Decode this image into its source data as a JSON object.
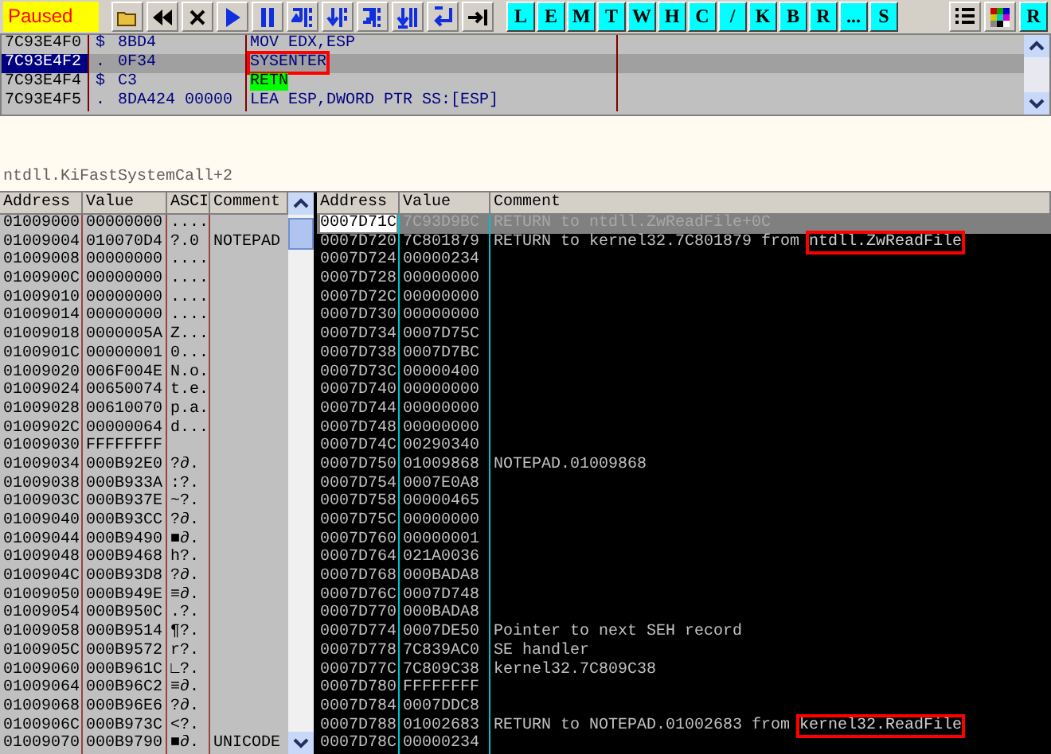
{
  "toolbar": {
    "status": "Paused",
    "tools": [
      {
        "kind": "open"
      },
      {
        "kind": "restart"
      },
      {
        "kind": "close"
      },
      {
        "kind": "run"
      },
      {
        "kind": "pause"
      },
      {
        "kind": "step-in"
      },
      {
        "kind": "step-over"
      },
      {
        "kind": "trace-in"
      },
      {
        "kind": "trace-over"
      },
      {
        "kind": "till-return"
      },
      {
        "kind": "goto"
      }
    ],
    "letters": [
      "L",
      "E",
      "M",
      "T",
      "W",
      "H",
      "C",
      "/",
      "K",
      "B",
      "R",
      "...",
      "S"
    ],
    "right_tools": [
      {
        "kind": "list"
      },
      {
        "kind": "grid"
      },
      {
        "kind": "letter",
        "label": "R"
      }
    ]
  },
  "disassembly": {
    "rows": [
      {
        "address": "7C93E4F0",
        "mark": "$",
        "hex": "8BD4",
        "instruction": "MOV EDX,ESP",
        "selected": false,
        "kind": "plain"
      },
      {
        "address": "7C93E4F2",
        "mark": ".",
        "hex": "0F34",
        "instruction": "SYSENTER",
        "selected": true,
        "kind": "boxed"
      },
      {
        "address": "7C93E4F4",
        "mark": "$",
        "hex": "C3",
        "instruction": "RETN",
        "selected": false,
        "kind": "return"
      },
      {
        "address": "7C93E4F5",
        "mark": ".",
        "hex": "8DA424 00000",
        "instruction": "LEA ESP,DWORD PTR SS:[ESP]",
        "selected": false,
        "kind": "plain"
      }
    ]
  },
  "info": {
    "text": "ntdll.KiFastSystemCall+2"
  },
  "dump": {
    "columns": [
      "Address",
      "Value",
      "ASCI",
      "Comment"
    ],
    "rows": [
      {
        "address": "01009000",
        "value": "00000000",
        "ascii": "...."
      },
      {
        "address": "01009004",
        "value": "010070D4",
        "ascii": "?.0",
        "comment": "NOTEPAD"
      },
      {
        "address": "01009008",
        "value": "00000000",
        "ascii": "...."
      },
      {
        "address": "0100900C",
        "value": "00000000",
        "ascii": "...."
      },
      {
        "address": "01009010",
        "value": "00000000",
        "ascii": "...."
      },
      {
        "address": "01009014",
        "value": "00000000",
        "ascii": "...."
      },
      {
        "address": "01009018",
        "value": "0000005A",
        "ascii": "Z..."
      },
      {
        "address": "0100901C",
        "value": "00000001",
        "ascii": "0..."
      },
      {
        "address": "01009020",
        "value": "006F004E",
        "ascii": "N.o."
      },
      {
        "address": "01009024",
        "value": "00650074",
        "ascii": "t.e."
      },
      {
        "address": "01009028",
        "value": "00610070",
        "ascii": "p.a."
      },
      {
        "address": "0100902C",
        "value": "00000064",
        "ascii": "d..."
      },
      {
        "address": "01009030",
        "value": "FFFFFFFF"
      },
      {
        "address": "01009034",
        "value": "000B92E0",
        "ascii": "?∂."
      },
      {
        "address": "01009038",
        "value": "000B933A",
        "ascii": ":?."
      },
      {
        "address": "0100903C",
        "value": "000B937E",
        "ascii": "~?."
      },
      {
        "address": "01009040",
        "value": "000B93CC",
        "ascii": "?∂."
      },
      {
        "address": "01009044",
        "value": "000B9490",
        "ascii": "■∂."
      },
      {
        "address": "01009048",
        "value": "000B9468",
        "ascii": "h?."
      },
      {
        "address": "0100904C",
        "value": "000B93D8",
        "ascii": "?∂."
      },
      {
        "address": "01009050",
        "value": "000B949E",
        "ascii": "≡∂."
      },
      {
        "address": "01009054",
        "value": "000B950C",
        "ascii": ".?."
      },
      {
        "address": "01009058",
        "value": "000B9514",
        "ascii": "¶?."
      },
      {
        "address": "0100905C",
        "value": "000B9572",
        "ascii": "r?."
      },
      {
        "address": "01009060",
        "value": "000B961C",
        "ascii": "∟?."
      },
      {
        "address": "01009064",
        "value": "000B96C2",
        "ascii": "≡∂."
      },
      {
        "address": "01009068",
        "value": "000B96E6",
        "ascii": "?∂."
      },
      {
        "address": "0100906C",
        "value": "000B973C",
        "ascii": "<?."
      },
      {
        "address": "01009070",
        "value": "000B9790",
        "ascii": "■∂.",
        "comment": "UNICODE"
      }
    ]
  },
  "stack": {
    "columns": [
      "Address",
      "Value",
      "Comment"
    ],
    "rows": [
      {
        "address": "0007D71C",
        "value": "7C93D9BC",
        "comment": "RETURN to ntdll.ZwReadFile+0C",
        "selected": true
      },
      {
        "address": "0007D720",
        "value": "7C801879",
        "comment": "RETURN to kernel32.7C801879 from ",
        "boxed": "ntdll.ZwReadFile",
        "selected": false
      },
      {
        "address": "0007D724",
        "value": "00000234",
        "selected": false
      },
      {
        "address": "0007D728",
        "value": "00000000",
        "selected": false
      },
      {
        "address": "0007D72C",
        "value": "00000000",
        "selected": false
      },
      {
        "address": "0007D730",
        "value": "00000000",
        "selected": false
      },
      {
        "address": "0007D734",
        "value": "0007D75C",
        "selected": false
      },
      {
        "address": "0007D738",
        "value": "0007D7BC",
        "selected": false
      },
      {
        "address": "0007D73C",
        "value": "00000400",
        "selected": false
      },
      {
        "address": "0007D740",
        "value": "00000000",
        "selected": false
      },
      {
        "address": "0007D744",
        "value": "00000000",
        "selected": false
      },
      {
        "address": "0007D748",
        "value": "00000000",
        "selected": false
      },
      {
        "address": "0007D74C",
        "value": "00290340",
        "selected": false
      },
      {
        "address": "0007D750",
        "value": "01009868",
        "comment": "NOTEPAD.01009868",
        "selected": false
      },
      {
        "address": "0007D754",
        "value": "0007E0A8",
        "selected": false
      },
      {
        "address": "0007D758",
        "value": "00000465",
        "selected": false
      },
      {
        "address": "0007D75C",
        "value": "00000000",
        "selected": false
      },
      {
        "address": "0007D760",
        "value": "00000001",
        "selected": false
      },
      {
        "address": "0007D764",
        "value": "021A0036",
        "selected": false
      },
      {
        "address": "0007D768",
        "value": "000BADA8",
        "selected": false
      },
      {
        "address": "0007D76C",
        "value": "0007D748",
        "selected": false
      },
      {
        "address": "0007D770",
        "value": "000BADA8",
        "selected": false
      },
      {
        "address": "0007D774",
        "value": "0007DE50",
        "comment": "Pointer to next SEH record",
        "selected": false
      },
      {
        "address": "0007D778",
        "value": "7C839AC0",
        "comment": "SE handler",
        "selected": false
      },
      {
        "address": "0007D77C",
        "value": "7C809C38",
        "comment": "kernel32.7C809C38",
        "selected": false
      },
      {
        "address": "0007D780",
        "value": "FFFFFFFF",
        "selected": false
      },
      {
        "address": "0007D784",
        "value": "0007DDC8",
        "selected": false
      },
      {
        "address": "0007D788",
        "value": "01002683",
        "comment": "RETURN to NOTEPAD.01002683 from ",
        "boxed": "kernel32.ReadFile",
        "selected": false
      },
      {
        "address": "0007D78C",
        "value": "00000234",
        "selected": false
      }
    ]
  }
}
